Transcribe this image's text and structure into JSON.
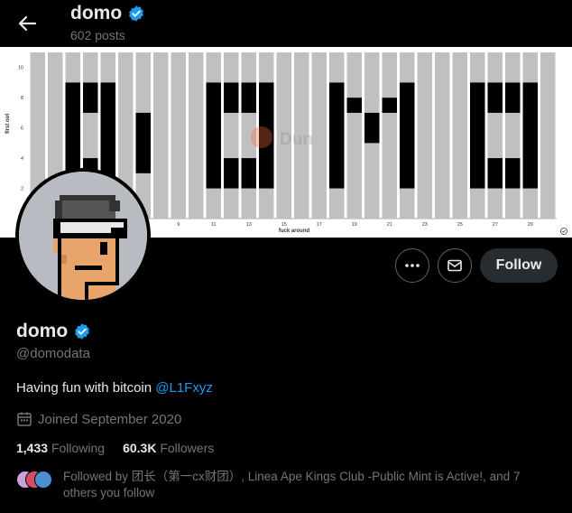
{
  "header": {
    "name": "domo",
    "posts": "602 posts"
  },
  "banner": {
    "y_axis_label": "first out",
    "x_axis_label": "fuck around",
    "y_ticks": [
      "10",
      "8",
      "6",
      "4",
      "2"
    ],
    "x_ticks": [
      "9",
      "11",
      "13",
      "15",
      "17",
      "19",
      "21",
      "23",
      "25",
      "27",
      "29"
    ],
    "watermark": "Dun"
  },
  "actions": {
    "follow_label": "Follow"
  },
  "profile": {
    "name": "domo",
    "handle": "@domodata",
    "bio_text": "Having fun with bitcoin ",
    "bio_link": "@L1Fxyz",
    "joined": "Joined September 2020",
    "following_count": "1,433",
    "following_label": "Following",
    "followers_count": "60.3K",
    "followers_label": "Followers",
    "followed_by": "Followed by 团长（第一cx财团）, Linea Ape Kings Club -Public Mint is Active!, and 7 others you follow"
  },
  "colors": {
    "verified": "#1d9bf0",
    "link": "#1d9bf0",
    "follow_button": "#272c30"
  }
}
